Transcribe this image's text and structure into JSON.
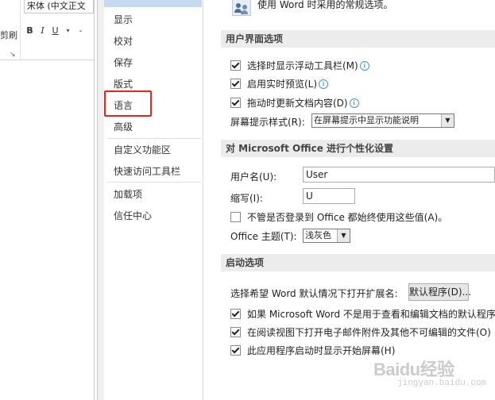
{
  "ribbon": {
    "font_name": "宋体 (中文正文",
    "paste_fragment": "剪刷",
    "bold": "B",
    "italic": "I",
    "underline": "U",
    "dropdown": "▾",
    "separator": "-",
    "launcher": "↘"
  },
  "sidebar": {
    "items": [
      "显示",
      "校对",
      "保存",
      "版式",
      "语言",
      "高级",
      "自定义功能区",
      "快速访问工具栏",
      "加载项",
      "信任中心"
    ],
    "highlighted_item": "语言",
    "highlight_color": "#e8261b"
  },
  "content": {
    "intro": "使用 Word 时采用的常规选项。",
    "ui_section": {
      "title": "用户界面选项",
      "show_mini_toolbar": {
        "label": "选择时显示浮动工具栏(M)",
        "checked": true
      },
      "live_preview": {
        "label": "启用实时预览(L)",
        "checked": true
      },
      "update_on_drag": {
        "label": "拖动时更新文档内容(D)",
        "checked": true
      },
      "tooltip_style_label": "屏幕提示样式(R):",
      "tooltip_style_value": "在屏幕提示中显示功能说明"
    },
    "personalize_section": {
      "title": "对 Microsoft Office 进行个性化设置",
      "username_label": "用户名(U):",
      "username_value": "User",
      "initials_label": "缩写(I):",
      "initials_value": "U",
      "always_use": {
        "label": "不管是否登录到 Office 都始终使用这些值(A)。",
        "checked": false
      },
      "theme_label": "Office 主题(T):",
      "theme_value": "浅灰色"
    },
    "startup_section": {
      "title": "启动选项",
      "default_ext_label": "选择希望 Word 默认情况下打开扩展名:",
      "default_programs_button": "默认程序(D)...",
      "tell_me_default": {
        "label": "如果 Microsoft Word 不是用于查看和编辑文档的默认程序",
        "checked": true
      },
      "open_email_reading": {
        "label": "在阅读视图下打开电子邮件附件及其他不可编辑的文件(O)",
        "checked": true
      },
      "show_start_screen": {
        "label": "此应用程序启动时显示开始屏幕(H)",
        "checked": true
      }
    }
  },
  "watermark": {
    "brand": "Baidu经验",
    "url": "jingyan.baidu.com"
  },
  "colors": {
    "section_header_bg": "#ececec",
    "sidebar_stub": "#c5d9f0",
    "info_icon": "#4a90d9"
  }
}
